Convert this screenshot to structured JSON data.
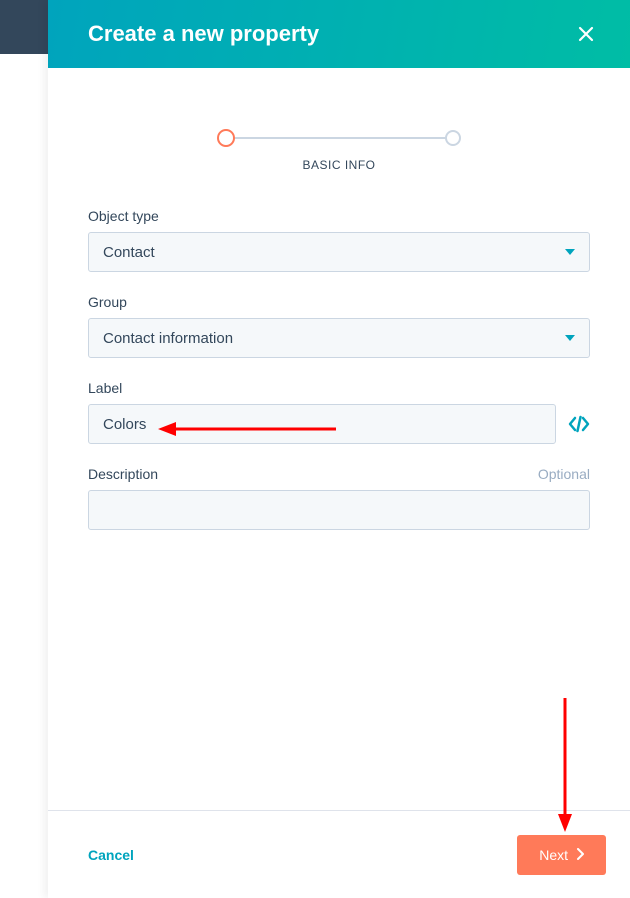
{
  "modal": {
    "title": "Create a new property",
    "stepper": {
      "active_label": "BASIC INFO"
    },
    "fields": {
      "object_type": {
        "label": "Object type",
        "value": "Contact"
      },
      "group": {
        "label": "Group",
        "value": "Contact information"
      },
      "label_field": {
        "label": "Label",
        "value": "Colors"
      },
      "description": {
        "label": "Description",
        "optional_text": "Optional",
        "value": ""
      }
    },
    "footer": {
      "cancel": "Cancel",
      "next": "Next"
    }
  },
  "colors": {
    "accent_teal": "#00a4bd",
    "accent_orange": "#ff7a59",
    "border": "#cbd6e2",
    "text": "#33475b"
  }
}
